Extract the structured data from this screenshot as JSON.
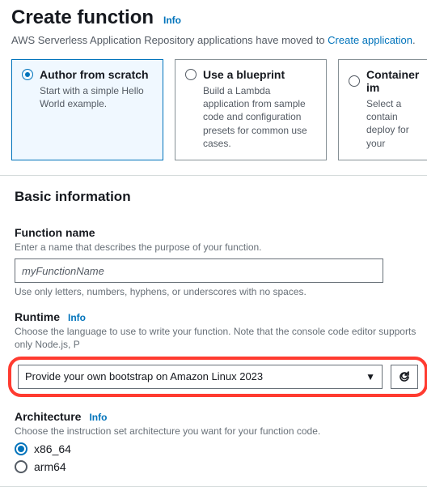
{
  "header": {
    "title": "Create function",
    "info": "Info"
  },
  "banner": {
    "text": "AWS Serverless Application Repository applications have moved to ",
    "link": "Create application",
    "suffix": "."
  },
  "cards": [
    {
      "title": "Author from scratch",
      "desc": "Start with a simple Hello World example.",
      "selected": true
    },
    {
      "title": "Use a blueprint",
      "desc": "Build a Lambda application from sample code and configuration presets for common use cases.",
      "selected": false
    },
    {
      "title": "Container im",
      "desc": "Select a contain deploy for your",
      "selected": false
    }
  ],
  "panel": {
    "heading": "Basic information",
    "functionName": {
      "label": "Function name",
      "hint": "Enter a name that describes the purpose of your function.",
      "value": "myFunctionName",
      "below": "Use only letters, numbers, hyphens, or underscores with no spaces."
    },
    "runtime": {
      "label": "Runtime",
      "info": "Info",
      "hint": "Choose the language to use to write your function. Note that the console code editor supports only Node.js, P",
      "selected": "Provide your own bootstrap on Amazon Linux 2023"
    },
    "architecture": {
      "label": "Architecture",
      "info": "Info",
      "hint": "Choose the instruction set architecture you want for your function code.",
      "options": [
        {
          "label": "x86_64",
          "checked": true
        },
        {
          "label": "arm64",
          "checked": false
        }
      ]
    }
  }
}
